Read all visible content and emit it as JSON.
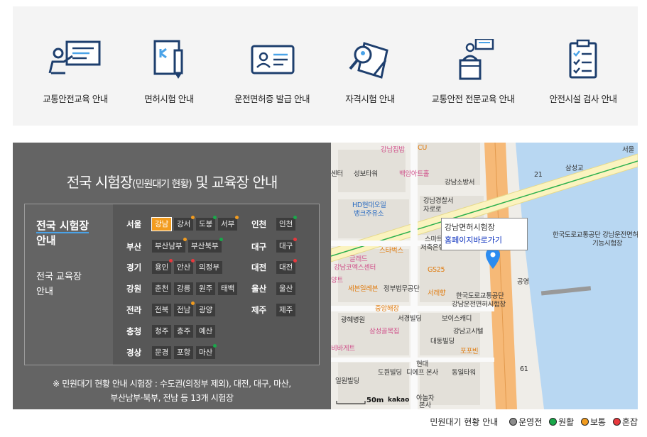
{
  "services": [
    {
      "label": "교통안전교육 안내",
      "icon": "presentation-board-icon"
    },
    {
      "label": "면허시험 안내",
      "icon": "application-pen-icon"
    },
    {
      "label": "운전면허증 발급 안내",
      "icon": "id-card-icon"
    },
    {
      "label": "자격시험 안내",
      "icon": "magnifier-document-icon"
    },
    {
      "label": "교통안전 전문교육 안내",
      "icon": "lecturer-podium-icon"
    },
    {
      "label": "안전시설 검사 안내",
      "icon": "checklist-clipboard-icon"
    }
  ],
  "exam": {
    "title_main": "전국 시험장",
    "title_small": "(민원대기 현황)",
    "title_tail": " 및 교육장 안내",
    "tab_active": "전국 시험장 안내",
    "tab_active_1": "전국 시험장",
    "tab_active_2": "안내",
    "tab_inactive_1": "전국 교육장",
    "tab_inactive_2": "안내",
    "regions": {
      "seoul": "서울",
      "busan": "부산",
      "gyeonggi": "경기",
      "gangwon": "강원",
      "jeolla": "전라",
      "chungcheong": "충청",
      "gyeongsang": "경상",
      "incheon": "인천",
      "daegu": "대구",
      "daejeon": "대전",
      "ulsan": "울산",
      "jeju": "제주"
    },
    "centers": {
      "gangnam": "강남",
      "gangseo": "강서",
      "dobong": "도봉",
      "seobu": "서부",
      "busan_nambu": "부산남부",
      "busan_bukbu": "부산북부",
      "yongin": "용인",
      "ansan": "안산",
      "uijeongbu": "의정부",
      "chuncheon": "춘천",
      "gangneung": "강릉",
      "wonju": "원주",
      "taebaek": "태백",
      "jeonbuk": "전북",
      "jeonnam": "전남",
      "gwangyang": "광양",
      "cheongju": "청주",
      "chungju": "충주",
      "yesan": "예산",
      "mungyeong": "문경",
      "pohang": "포항",
      "masan": "마산",
      "incheon": "인천",
      "daegu": "대구",
      "daejeon": "대전",
      "ulsan": "울산",
      "jeju": "제주"
    },
    "note_line1": "※ 민원대기 현황 안내 시험장 : 수도권(의정부 제외), 대전, 대구, 마산,",
    "note_line2": "부산남부·북부, 전남 등 13개 시험장"
  },
  "map": {
    "popup_title": "강남면허시험장",
    "popup_link": "홈페이지바로가기",
    "scale_label": "50m",
    "brand": "kakao",
    "labels": {
      "l1": "강남집밥",
      "l2": "CU",
      "l3": "성보타워",
      "l4": "백암아트홀",
      "l5": "강남소방서",
      "l6": "강남경찰서",
      "l7": "자로로",
      "l8": "HD현대오일",
      "l9": "뱅크주유소",
      "l10": "삼성교",
      "l11": "스마트",
      "l12": "저축은행",
      "l13": "스타벅스",
      "l14": "글래드",
      "l15": "강남코엑스센터",
      "l16": "GS25",
      "l17": "세븐일레븐",
      "l18": "정부법무공단",
      "l19": "서래향",
      "l20": "한국도로교통공단",
      "l21": "강남운전면허시험장",
      "l22": "중앙해장",
      "l23": "서경빌딩",
      "l24": "보이스캐디",
      "l25": "광혜병원",
      "l26": "삼성골목집",
      "l27": "강남고시텔",
      "l28": "대동빌딩",
      "l29": "포포빈",
      "l30": "현대",
      "l31": "디에프 본사",
      "l32": "도원빌딩",
      "l33": "동일타워",
      "l34": "일원빌딩",
      "l35": "야놀자",
      "l36": "본사",
      "l37": "공영",
      "l38": "한국도로교통공단 강남운전면허",
      "l39": "기능시험장",
      "l40": "서울",
      "l41": "센터",
      "l42": "트",
      "l43": "양트",
      "l44": "비바게트",
      "l45": "61",
      "l46": "21"
    }
  },
  "legend": {
    "title": "민원대기 현황 안내",
    "items": [
      {
        "label": "운영전",
        "color": "#8c8c8c"
      },
      {
        "label": "원활",
        "color": "#1aa84a"
      },
      {
        "label": "보통",
        "color": "#f29c1f"
      },
      {
        "label": "혼잡",
        "color": "#e8383d"
      }
    ]
  },
  "colors": {
    "accent": "#f29c1f",
    "green": "#1aa84a",
    "red": "#e8383d",
    "panel": "#646464"
  }
}
